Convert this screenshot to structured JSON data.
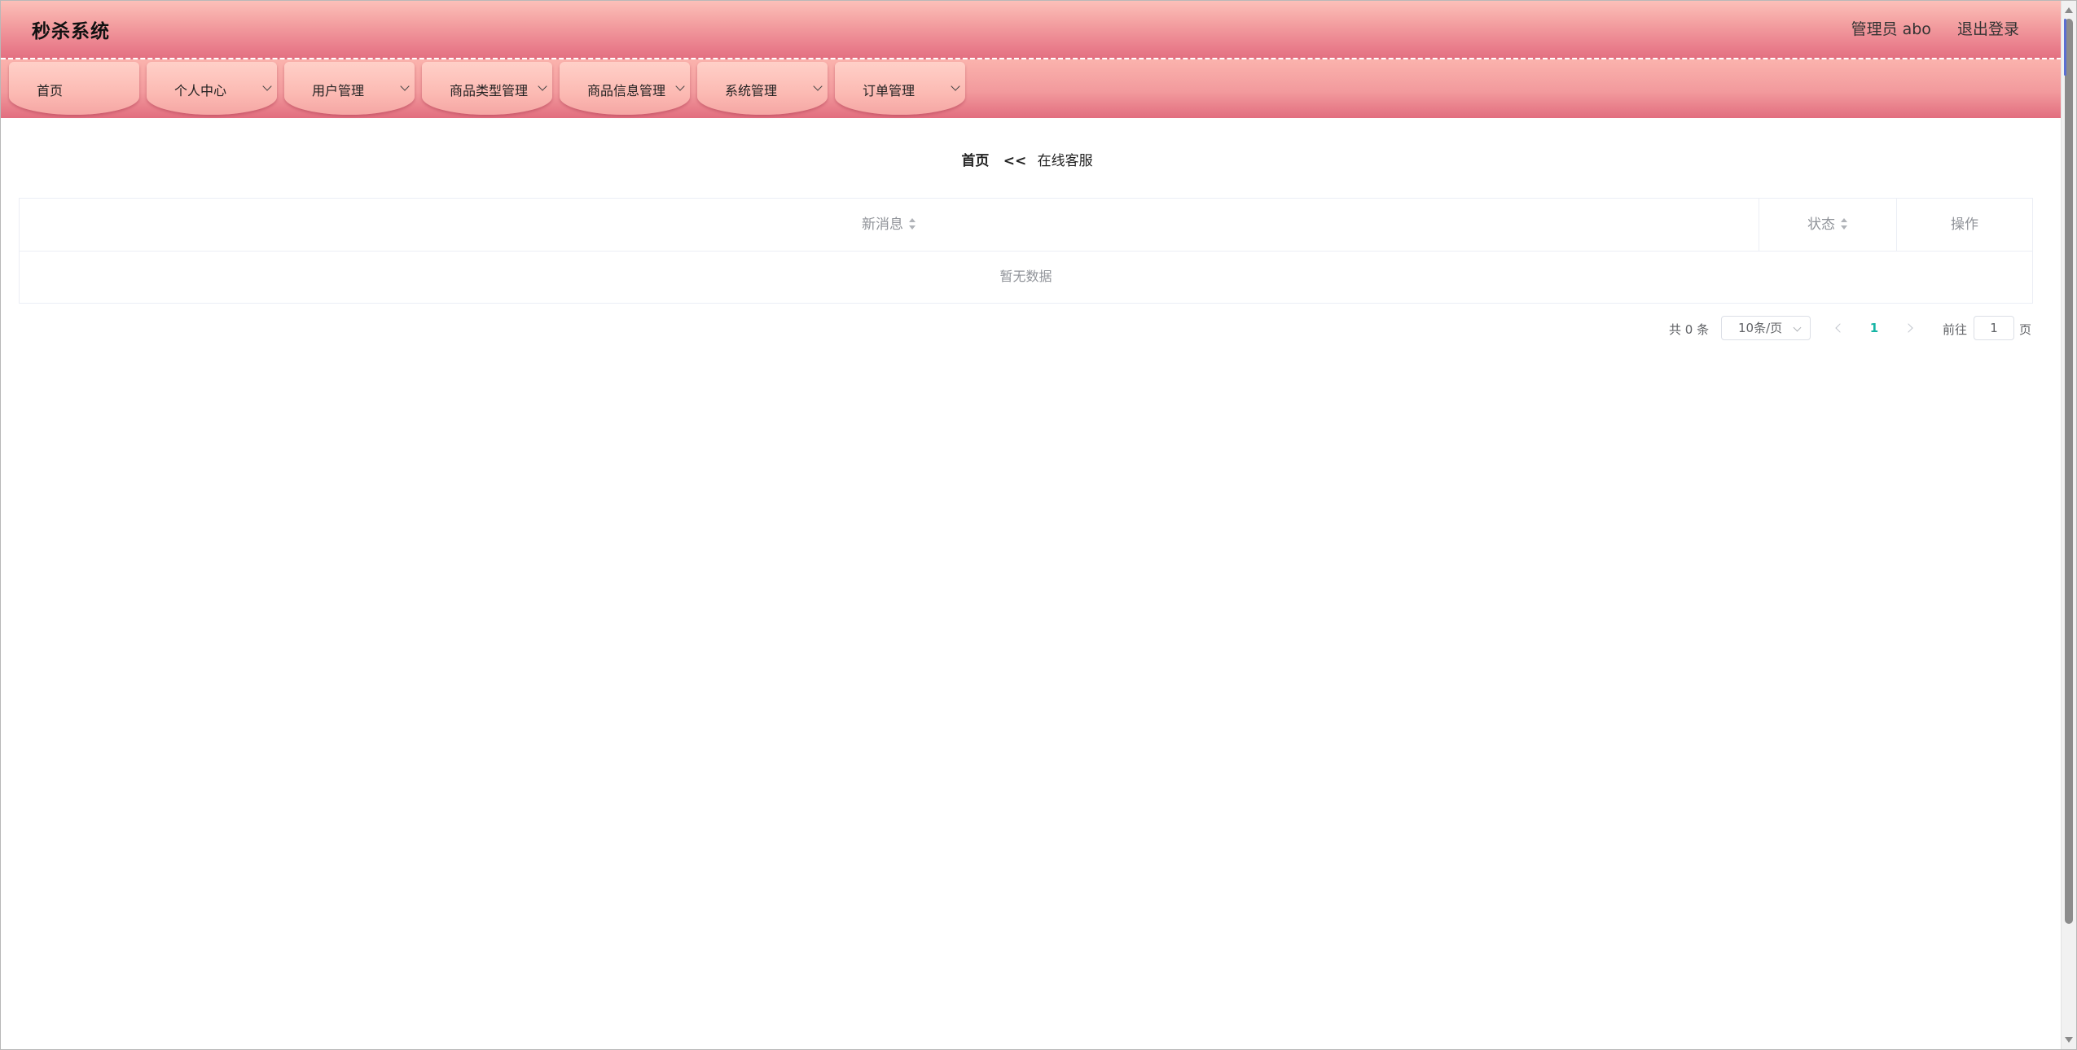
{
  "header": {
    "app_title": "秒杀系统",
    "user_label": "管理员 abo",
    "logout_label": "退出登录"
  },
  "nav": {
    "items": [
      {
        "label": "首页",
        "has_dropdown": false
      },
      {
        "label": "个人中心",
        "has_dropdown": true
      },
      {
        "label": "用户管理",
        "has_dropdown": true
      },
      {
        "label": "商品类型管理",
        "has_dropdown": true
      },
      {
        "label": "商品信息管理",
        "has_dropdown": true
      },
      {
        "label": "系统管理",
        "has_dropdown": true
      },
      {
        "label": "订单管理",
        "has_dropdown": true
      }
    ]
  },
  "breadcrumb": {
    "home": "首页",
    "separator": "<<",
    "current": "在线客服"
  },
  "table": {
    "columns": [
      "新消息",
      "状态",
      "操作"
    ],
    "empty_text": "暂无数据"
  },
  "pagination": {
    "total": "共 0 条",
    "page_size": "10条/页",
    "current_page": "1",
    "goto_label": "前往",
    "goto_value": "1",
    "goto_suffix": "页"
  },
  "colors": {
    "header_top": "#fcc0b9",
    "header_bottom": "#e26f80",
    "nav_tab": "#fcbab3",
    "pagination_active": "#16b5a5"
  }
}
